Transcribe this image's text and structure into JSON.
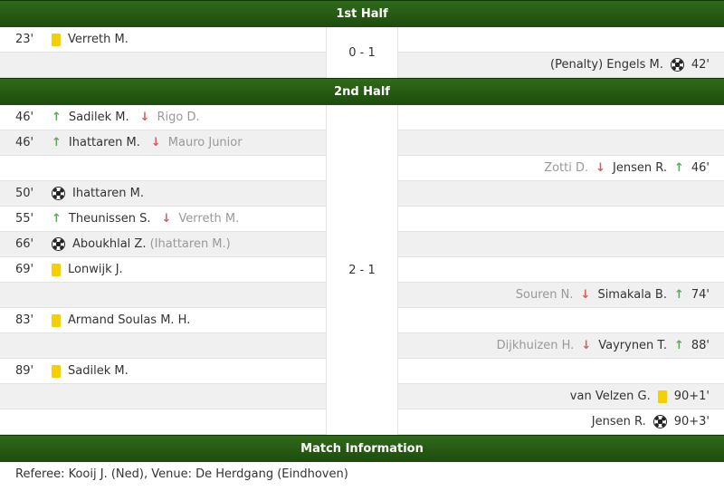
{
  "first_half": {
    "title": "1st Half",
    "score": "0 - 1",
    "rows": [
      {
        "side": "left",
        "minute": "23'",
        "icon": "yellow-card",
        "name": "Verreth M.",
        "extra": ""
      },
      {
        "side": "right",
        "minute": "42'",
        "icon": "goal-ball",
        "name": "Engels M.",
        "extra": "(Penalty)"
      }
    ]
  },
  "second_half": {
    "title": "2nd Half",
    "score": "2 - 1",
    "rows": [
      {
        "side": "left",
        "minute": "46'",
        "icon": "sub",
        "in": "Sadilek M.",
        "out": "Rigo D."
      },
      {
        "side": "left",
        "minute": "46'",
        "icon": "sub",
        "in": "Ihattaren M.",
        "out": "Mauro Junior"
      },
      {
        "side": "right",
        "minute": "46'",
        "icon": "sub",
        "in": "Jensen R.",
        "out": "Zotti D."
      },
      {
        "side": "left",
        "minute": "50'",
        "icon": "goal-ball",
        "name": "Ihattaren M.",
        "extra": ""
      },
      {
        "side": "left",
        "minute": "55'",
        "icon": "sub",
        "in": "Theunissen S.",
        "out": "Verreth M."
      },
      {
        "side": "left",
        "minute": "66'",
        "icon": "goal-ball",
        "name": "Aboukhlal Z.",
        "extra": "(Ihattaren M.)"
      },
      {
        "side": "left",
        "minute": "69'",
        "icon": "yellow-card",
        "name": "Lonwijk J.",
        "extra": ""
      },
      {
        "side": "right",
        "minute": "74'",
        "icon": "sub",
        "in": "Simakala B.",
        "out": "Souren N."
      },
      {
        "side": "left",
        "minute": "83'",
        "icon": "yellow-card",
        "name": "Armand Soulas M. H.",
        "extra": ""
      },
      {
        "side": "right",
        "minute": "88'",
        "icon": "sub",
        "in": "Vayrynen T.",
        "out": "Dijkhuizen H."
      },
      {
        "side": "left",
        "minute": "89'",
        "icon": "yellow-card",
        "name": "Sadilek M.",
        "extra": ""
      },
      {
        "side": "right",
        "minute": "90+1'",
        "icon": "yellow-card",
        "name": "van Velzen G.",
        "extra": ""
      },
      {
        "side": "right",
        "minute": "90+3'",
        "icon": "goal-ball",
        "name": "Jensen R.",
        "extra": ""
      }
    ]
  },
  "match_info": {
    "title": "Match Information",
    "text": "Referee: Kooij J. (Ned), Venue: De Herdgang (Eindhoven)"
  },
  "icons": {
    "sub_in": "arrow-up-icon",
    "sub_out": "arrow-down-icon",
    "card": "yellow-card-icon",
    "goal": "ball-icon"
  },
  "colors": {
    "header_bg": "#24561a",
    "yellow_card": "#f5d000",
    "sub_in": "#5aa85a",
    "sub_out": "#d06060"
  }
}
